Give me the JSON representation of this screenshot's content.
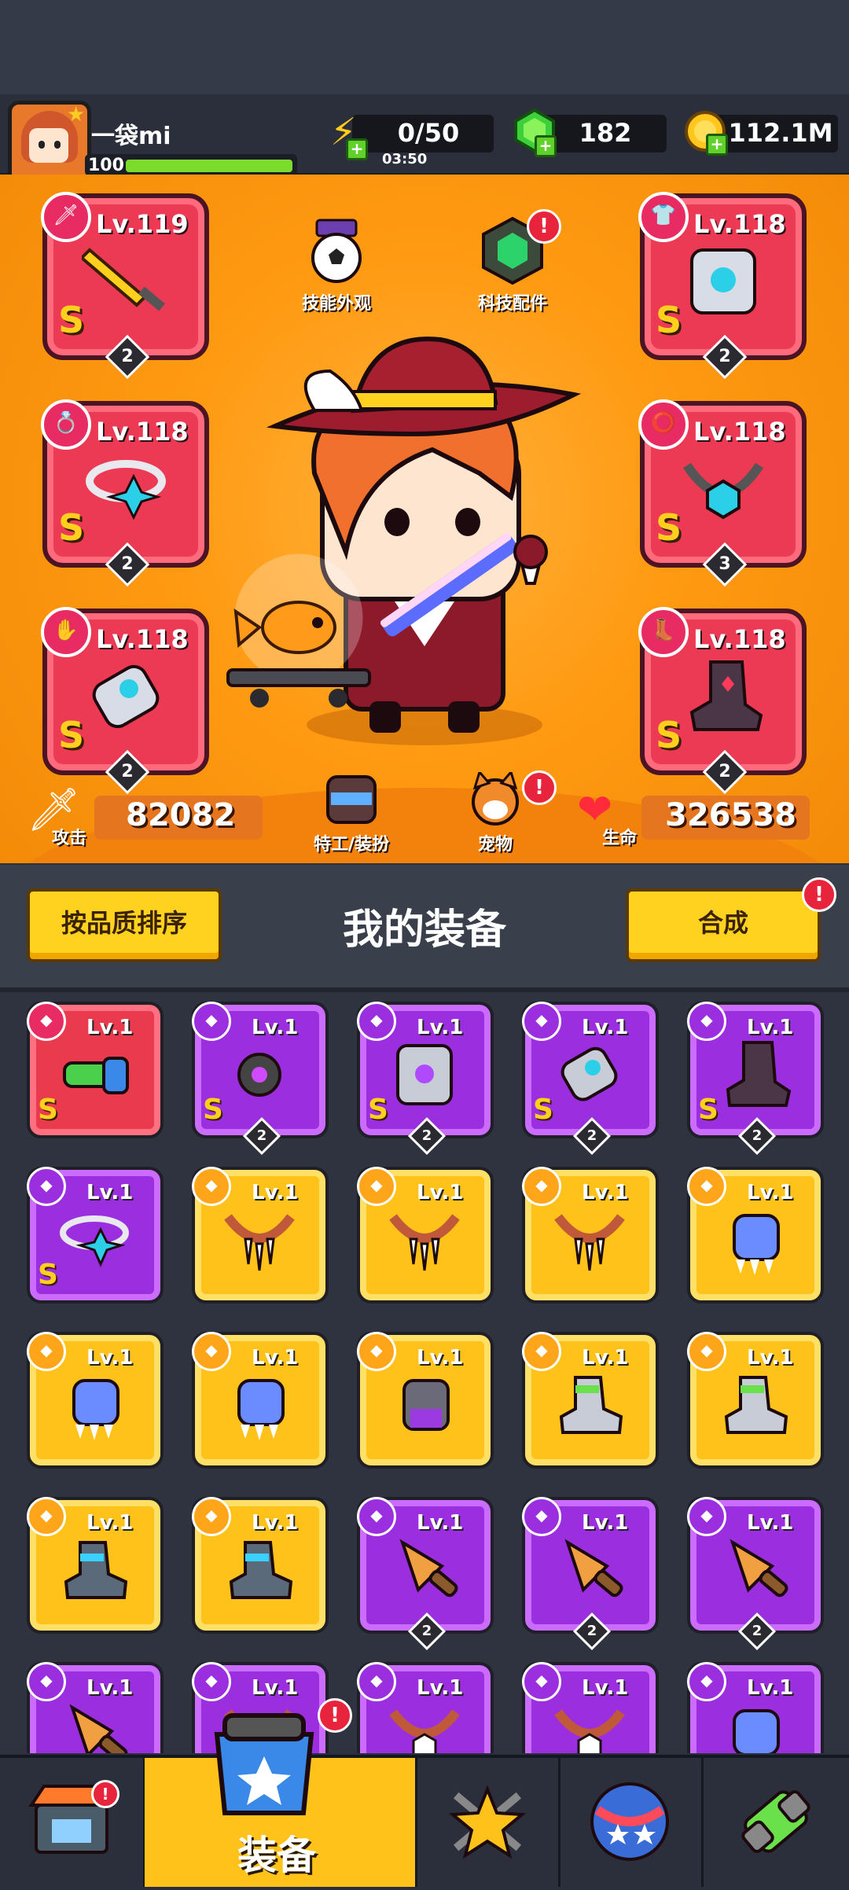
{
  "player": {
    "name": "一袋mi",
    "level": "100"
  },
  "resources": {
    "energy": {
      "value": "0/50",
      "timer": "03:50",
      "icon": "lightning-icon"
    },
    "gems": {
      "value": "182",
      "icon": "green-gem-icon"
    },
    "coins": {
      "value": "112.1M",
      "icon": "gold-coin-icon"
    }
  },
  "character": {
    "skill_skin_label": "技能外观",
    "tech_parts_label": "科技配件",
    "agent_label": "特工/装扮",
    "pet_label": "宠物",
    "attack_label": "攻击",
    "attack_value": "82082",
    "hp_label": "生命",
    "hp_value": "326538",
    "slots": [
      {
        "id": "weapon",
        "level": "Lv.119",
        "grade": "S",
        "count": "2",
        "icon": "sword-icon"
      },
      {
        "id": "armor",
        "level": "Lv.118",
        "grade": "S",
        "count": "2",
        "icon": "armor-icon"
      },
      {
        "id": "ring",
        "level": "Lv.118",
        "grade": "S",
        "count": "2",
        "icon": "ring-icon"
      },
      {
        "id": "necklace",
        "level": "Lv.118",
        "grade": "S",
        "count": "3",
        "icon": "necklace-icon"
      },
      {
        "id": "glove",
        "level": "Lv.118",
        "grade": "S",
        "count": "2",
        "icon": "glove-icon"
      },
      {
        "id": "boots",
        "level": "Lv.118",
        "grade": "S",
        "count": "2",
        "icon": "boots-icon"
      }
    ]
  },
  "panel": {
    "sort_label": "按品质排序",
    "title": "我的装备",
    "merge_label": "合成"
  },
  "inventory": [
    {
      "rarity": "red",
      "level": "Lv.1",
      "grade": "S",
      "count": "",
      "icon": "water-gun-icon"
    },
    {
      "rarity": "purple",
      "level": "Lv.1",
      "grade": "S",
      "count": "2",
      "icon": "spiked-blade-icon"
    },
    {
      "rarity": "purple",
      "level": "Lv.1",
      "grade": "S",
      "count": "2",
      "icon": "armor-icon"
    },
    {
      "rarity": "purple",
      "level": "Lv.1",
      "grade": "S",
      "count": "2",
      "icon": "glove-icon"
    },
    {
      "rarity": "purple",
      "level": "Lv.1",
      "grade": "S",
      "count": "2",
      "icon": "boots-icon"
    },
    {
      "rarity": "purple",
      "level": "Lv.1",
      "grade": "S",
      "count": "",
      "icon": "ring-icon"
    },
    {
      "rarity": "yellow",
      "level": "Lv.1",
      "grade": "",
      "count": "",
      "icon": "fang-necklace-icon"
    },
    {
      "rarity": "yellow",
      "level": "Lv.1",
      "grade": "",
      "count": "",
      "icon": "fang-necklace-icon"
    },
    {
      "rarity": "yellow",
      "level": "Lv.1",
      "grade": "",
      "count": "",
      "icon": "fang-necklace-icon"
    },
    {
      "rarity": "yellow",
      "level": "Lv.1",
      "grade": "",
      "count": "",
      "icon": "claw-glove-icon"
    },
    {
      "rarity": "yellow",
      "level": "Lv.1",
      "grade": "",
      "count": "",
      "icon": "claw-glove-icon"
    },
    {
      "rarity": "yellow",
      "level": "Lv.1",
      "grade": "",
      "count": "",
      "icon": "claw-glove-icon"
    },
    {
      "rarity": "yellow",
      "level": "Lv.1",
      "grade": "",
      "count": "",
      "icon": "mech-glove-icon"
    },
    {
      "rarity": "yellow",
      "level": "Lv.1",
      "grade": "",
      "count": "",
      "icon": "sneaker-icon"
    },
    {
      "rarity": "yellow",
      "level": "Lv.1",
      "grade": "",
      "count": "",
      "icon": "sneaker-icon"
    },
    {
      "rarity": "yellow",
      "level": "Lv.1",
      "grade": "",
      "count": "",
      "icon": "mech-boot-icon"
    },
    {
      "rarity": "yellow",
      "level": "Lv.1",
      "grade": "",
      "count": "",
      "icon": "mech-boot-icon"
    },
    {
      "rarity": "purple",
      "level": "Lv.1",
      "grade": "",
      "count": "2",
      "icon": "drill-icon"
    },
    {
      "rarity": "purple",
      "level": "Lv.1",
      "grade": "",
      "count": "2",
      "icon": "drill-icon"
    },
    {
      "rarity": "purple",
      "level": "Lv.1",
      "grade": "",
      "count": "2",
      "icon": "drill-icon"
    },
    {
      "rarity": "purple",
      "level": "Lv.1",
      "grade": "",
      "count": "",
      "icon": "drill-icon"
    },
    {
      "rarity": "purple",
      "level": "Lv.1",
      "grade": "",
      "count": "",
      "icon": "necklace-icon"
    },
    {
      "rarity": "purple",
      "level": "Lv.1",
      "grade": "",
      "count": "",
      "icon": "necklace-icon"
    },
    {
      "rarity": "purple",
      "level": "Lv.1",
      "grade": "",
      "count": "",
      "icon": "necklace-icon"
    },
    {
      "rarity": "purple",
      "level": "Lv.1",
      "grade": "",
      "count": "",
      "icon": "claw-glove-icon"
    }
  ],
  "nav": {
    "shop_icon": "shop-icon",
    "equip_label": "装备",
    "hero_icon": "star-swords-icon",
    "world_icon": "planet-icon",
    "gene_icon": "dna-icon"
  },
  "colors": {
    "slot_red": "#ec3a55",
    "rarity_purple": "#9b2fe0",
    "rarity_yellow": "#ffc21a",
    "accent_orange": "#ff9a12"
  }
}
